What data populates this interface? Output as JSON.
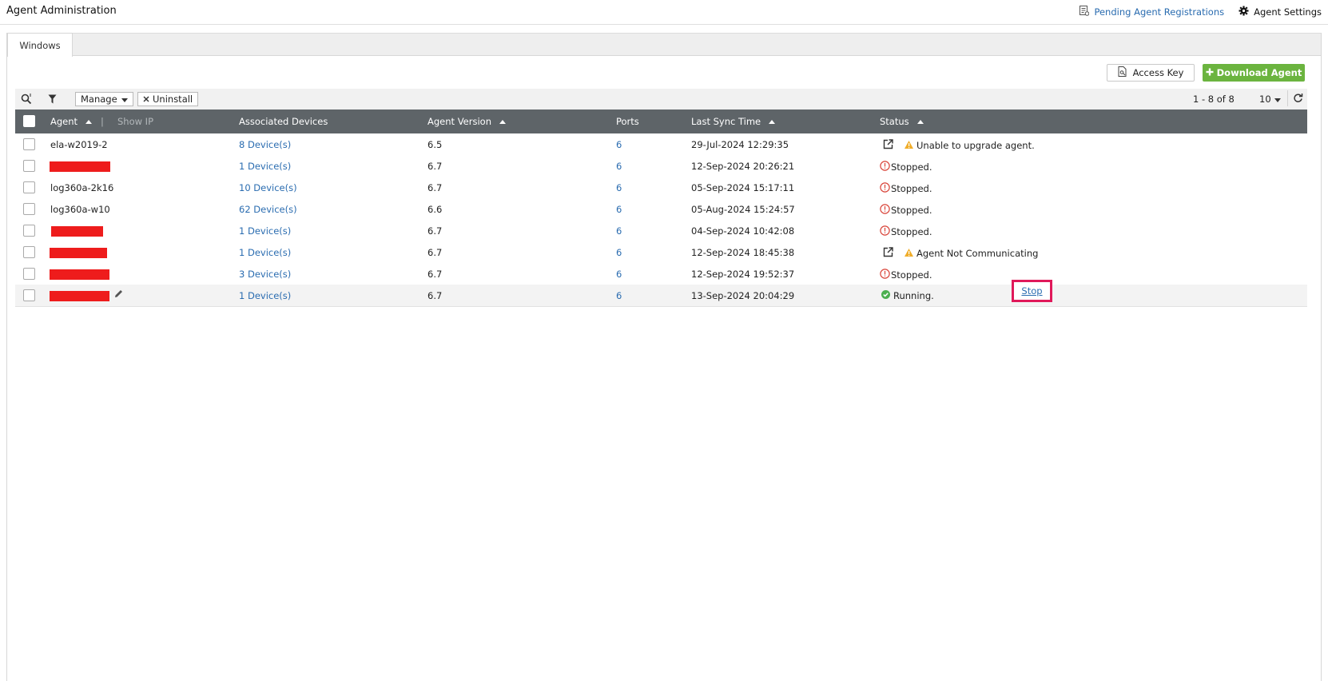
{
  "header": {
    "title": "Agent Administration",
    "pending_label": "Pending Agent Registrations",
    "settings_label": "Agent Settings"
  },
  "tabs": [
    {
      "label": "Windows",
      "active": true
    }
  ],
  "actions": {
    "access_key_label": "Access Key",
    "download_label": "Download Agent"
  },
  "toolbar": {
    "manage_label": "Manage",
    "uninstall_label": "Uninstall",
    "pager_text": "1 - 8 of 8",
    "page_size": "10"
  },
  "table": {
    "columns": {
      "agent": "Agent",
      "show_ip": "Show IP",
      "devices": "Associated Devices",
      "version": "Agent Version",
      "ports": "Ports",
      "sync": "Last Sync Time",
      "status": "Status"
    },
    "rows": [
      {
        "agent": "ela-w2019-2",
        "devices": "8 Device(s)",
        "version": "6.5",
        "ports": "6",
        "sync": "29-Jul-2024 12:29:35",
        "status": "Unable to upgrade agent."
      },
      {
        "agent": "",
        "devices": "1 Device(s)",
        "version": "6.7",
        "ports": "6",
        "sync": "12-Sep-2024 20:26:21",
        "status": "Stopped."
      },
      {
        "agent": "log360a-2k16",
        "devices": "10 Device(s)",
        "version": "6.7",
        "ports": "6",
        "sync": "05-Sep-2024 15:17:11",
        "status": "Stopped."
      },
      {
        "agent": "log360a-w10",
        "devices": "62 Device(s)",
        "version": "6.6",
        "ports": "6",
        "sync": "05-Aug-2024 15:24:57",
        "status": "Stopped."
      },
      {
        "agent": "",
        "devices": "1 Device(s)",
        "version": "6.7",
        "ports": "6",
        "sync": "04-Sep-2024 10:42:08",
        "status": "Stopped."
      },
      {
        "agent": "",
        "devices": "1 Device(s)",
        "version": "6.7",
        "ports": "6",
        "sync": "12-Sep-2024 18:45:38",
        "status": "Agent Not Communicating"
      },
      {
        "agent": "",
        "devices": "3 Device(s)",
        "version": "6.7",
        "ports": "6",
        "sync": "12-Sep-2024 19:52:37",
        "status": "Stopped."
      },
      {
        "agent": "",
        "devices": "1 Device(s)",
        "version": "6.7",
        "ports": "6",
        "sync": "13-Sep-2024 20:04:29",
        "status": "Running.",
        "action": "Stop"
      }
    ]
  },
  "colors": {
    "header_bg": "#5e6468",
    "link": "#2a6cb0",
    "download_green": "#6bb43f",
    "warning": "#f0ad2a",
    "error": "#d9453a",
    "running": "#4caf50",
    "redaction": "#ee1c1c",
    "highlight_box": "#e0195a"
  },
  "icons": {
    "pending": "registration-list-icon",
    "settings": "gear-icon",
    "access_key": "key-document-icon",
    "download": "plus-icon",
    "search": "search-icon",
    "filter": "filter-icon",
    "manage": "chevron-down-icon",
    "uninstall": "close-icon",
    "refresh": "refresh-icon",
    "edit": "pencil-icon",
    "external": "external-link-icon",
    "warning": "warning-triangle-icon",
    "error": "info-circle-icon",
    "running": "check-circle-icon"
  }
}
